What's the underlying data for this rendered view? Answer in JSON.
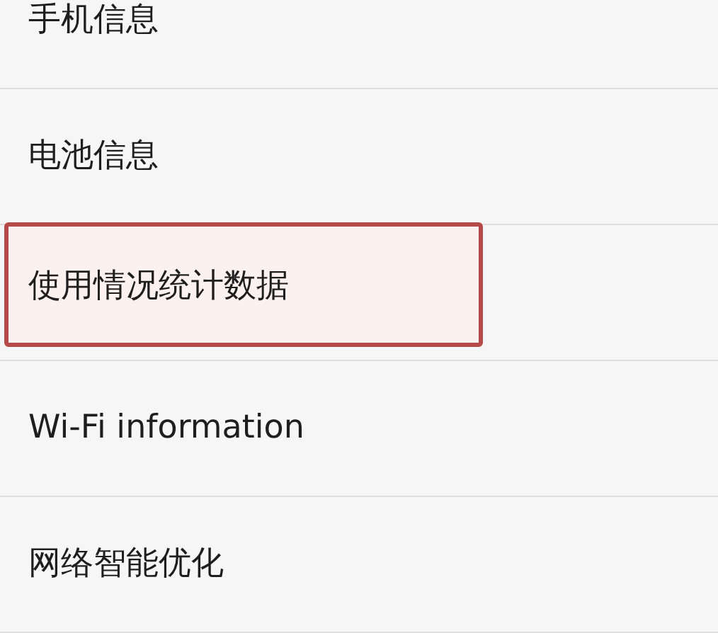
{
  "settings_list": [
    {
      "label": "手机信息",
      "highlighted": false
    },
    {
      "label": "电池信息",
      "highlighted": false
    },
    {
      "label": "使用情况统计数据",
      "highlighted": true
    },
    {
      "label": "Wi-Fi information",
      "highlighted": false
    },
    {
      "label": "网络智能优化",
      "highlighted": false
    }
  ]
}
